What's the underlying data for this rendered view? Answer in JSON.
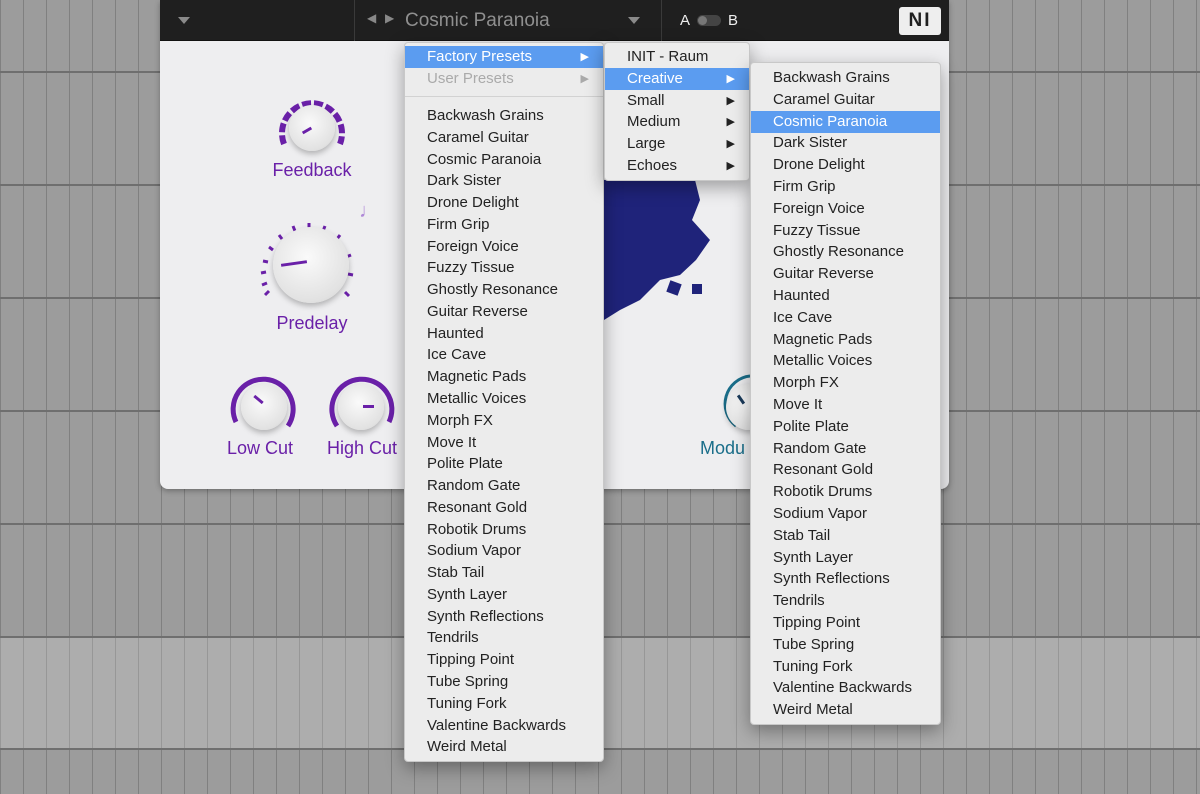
{
  "header": {
    "preset_name": "Cosmic Paranoia",
    "ab_a": "A",
    "ab_b": "B",
    "logo": "NI"
  },
  "knobs": {
    "feedback": "Feedback",
    "predelay": "Predelay",
    "low_cut": "Low Cut",
    "high_cut": "High Cut",
    "modulation": "Modu"
  },
  "colors": {
    "accent": "#6a20a8",
    "selection": "#5b9cf0",
    "mod_accent": "#1a6e8a",
    "splash": "#1f237a"
  },
  "menu1": {
    "factory": "Factory Presets",
    "user": "User Presets",
    "items": [
      "Backwash Grains",
      "Caramel Guitar",
      "Cosmic Paranoia",
      "Dark Sister",
      "Drone Delight",
      "Firm Grip",
      "Foreign Voice",
      "Fuzzy Tissue",
      "Ghostly Resonance",
      "Guitar Reverse",
      "Haunted",
      "Ice Cave",
      "Magnetic Pads",
      "Metallic Voices",
      "Morph FX",
      "Move It",
      "Polite Plate",
      "Random Gate",
      "Resonant Gold",
      "Robotik Drums",
      "Sodium Vapor",
      "Stab Tail",
      "Synth Layer",
      "Synth Reflections",
      "Tendrils",
      "Tipping Point",
      "Tube Spring",
      "Tuning Fork",
      "Valentine Backwards",
      "Weird Metal"
    ]
  },
  "menu2": {
    "items": [
      "INIT - Raum",
      "Creative",
      "Small",
      "Medium",
      "Large",
      "Echoes"
    ],
    "selected": "Creative"
  },
  "menu3": {
    "selected": "Cosmic Paranoia",
    "items": [
      "Backwash Grains",
      "Caramel Guitar",
      "Cosmic Paranoia",
      "Dark Sister",
      "Drone Delight",
      "Firm Grip",
      "Foreign Voice",
      "Fuzzy Tissue",
      "Ghostly Resonance",
      "Guitar Reverse",
      "Haunted",
      "Ice Cave",
      "Magnetic Pads",
      "Metallic Voices",
      "Morph FX",
      "Move It",
      "Polite Plate",
      "Random Gate",
      "Resonant Gold",
      "Robotik Drums",
      "Sodium Vapor",
      "Stab Tail",
      "Synth Layer",
      "Synth Reflections",
      "Tendrils",
      "Tipping Point",
      "Tube Spring",
      "Tuning Fork",
      "Valentine Backwards",
      "Weird Metal"
    ]
  }
}
